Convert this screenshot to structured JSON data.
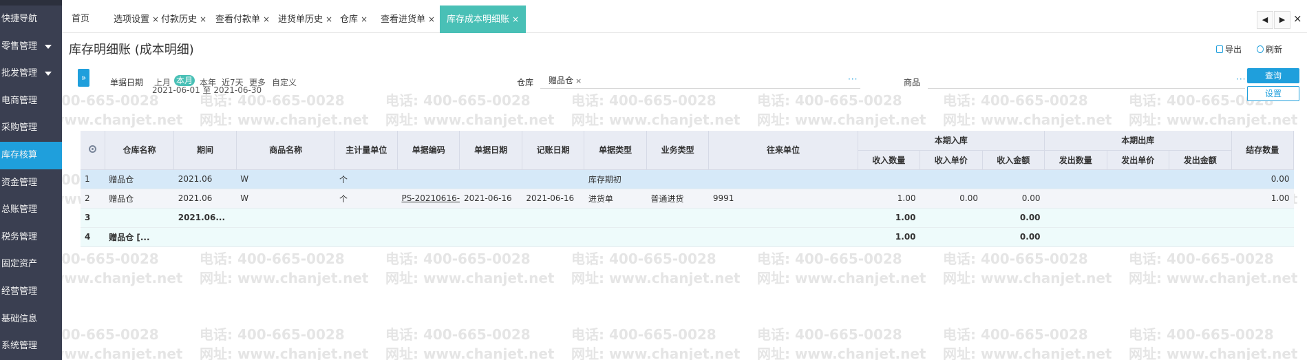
{
  "sidebar": {
    "items": [
      {
        "label": "快捷导航",
        "caret": false,
        "active": false
      },
      {
        "label": "零售管理",
        "caret": true,
        "active": false
      },
      {
        "label": "批发管理",
        "caret": true,
        "active": false
      },
      {
        "label": "电商管理",
        "caret": false,
        "active": false
      },
      {
        "label": "采购管理",
        "caret": false,
        "active": false
      },
      {
        "label": "库存核算",
        "caret": false,
        "active": true
      },
      {
        "label": "资金管理",
        "caret": false,
        "active": false
      },
      {
        "label": "总账管理",
        "caret": false,
        "active": false
      },
      {
        "label": "税务管理",
        "caret": false,
        "active": false
      },
      {
        "label": "固定资产",
        "caret": false,
        "active": false
      },
      {
        "label": "经营管理",
        "caret": false,
        "active": false
      },
      {
        "label": "基础信息",
        "caret": false,
        "active": false
      },
      {
        "label": "系统管理",
        "caret": false,
        "active": false
      }
    ]
  },
  "tabs": [
    {
      "label": "首页",
      "closable": false,
      "active": false
    },
    {
      "label": "选项设置",
      "closable": true,
      "active": false
    },
    {
      "label": "付款历史",
      "closable": true,
      "active": false
    },
    {
      "label": "查看付款单",
      "closable": true,
      "active": false
    },
    {
      "label": "进货单历史",
      "closable": true,
      "active": false
    },
    {
      "label": "仓库",
      "closable": true,
      "active": false
    },
    {
      "label": "查看进货单",
      "closable": true,
      "active": false
    },
    {
      "label": "库存成本明细账",
      "closable": true,
      "active": true
    }
  ],
  "tab_close_glyph": "×",
  "tab_nav": {
    "prev": "◀",
    "next": "▶",
    "close_all": "×"
  },
  "page": {
    "title": "库存明细账 (成本明细)",
    "export_label": "导出",
    "refresh_label": "刷新"
  },
  "filters": {
    "expand_glyph": "»",
    "date_label": "单据日期",
    "quick_options": [
      {
        "label": "上月",
        "active": false
      },
      {
        "label": "本月",
        "active": true
      },
      {
        "label": "本年",
        "active": false
      },
      {
        "label": "近7天",
        "active": false
      },
      {
        "label": "更多",
        "active": false
      },
      {
        "label": "自定义",
        "active": false
      }
    ],
    "date_range": "2021-06-01 至 2021-06-30",
    "warehouse_label": "仓库",
    "warehouse_chip": "赠品仓",
    "goods_label": "商品",
    "more_glyph": "···",
    "query_button": "查询",
    "settings_button": "设置"
  },
  "watermark": {
    "phone": "电话: 400-665-0028",
    "site": "网址: www.chanjet.net"
  },
  "table": {
    "headers": {
      "warehouse": "仓库名称",
      "period": "期间",
      "goods": "商品名称",
      "unit": "主计量单位",
      "doc_no": "单据编码",
      "doc_date": "单据日期",
      "post_date": "记账日期",
      "doc_type": "单据类型",
      "biz_type": "业务类型",
      "partner": "往来单位",
      "in_group": "本期入库",
      "out_group": "本期出库",
      "in_qty": "收入数量",
      "in_price": "收入单价",
      "in_amount": "收入金额",
      "out_qty": "发出数量",
      "out_price": "发出单价",
      "out_amount": "发出金额",
      "bal_qty": "结存数量"
    },
    "rows": [
      {
        "no": "1",
        "warehouse": "赠品仓",
        "period": "2021.06",
        "goods": "W",
        "unit": "个",
        "doc_no": "",
        "doc_date": "",
        "post_date": "",
        "doc_type": "库存期初",
        "biz_type": "",
        "partner": "",
        "in_qty": "",
        "in_price": "",
        "in_amount": "",
        "out_qty": "",
        "out_price": "",
        "out_amount": "",
        "bal_qty": "0.00"
      },
      {
        "no": "2",
        "warehouse": "赠品仓",
        "period": "2021.06",
        "goods": "W",
        "unit": "个",
        "doc_no": "PS-20210616-",
        "doc_date": "2021-06-16",
        "post_date": "2021-06-16",
        "doc_type": "进货单",
        "biz_type": "普通进货",
        "partner": "9991",
        "in_qty": "1.00",
        "in_price": "0.00",
        "in_amount": "0.00",
        "out_qty": "",
        "out_price": "",
        "out_amount": "",
        "bal_qty": "1.00"
      },
      {
        "no": "3",
        "warehouse": "",
        "period": "2021.06...",
        "goods": "",
        "unit": "",
        "doc_no": "",
        "doc_date": "",
        "post_date": "",
        "doc_type": "",
        "biz_type": "",
        "partner": "",
        "in_qty": "1.00",
        "in_price": "",
        "in_amount": "0.00",
        "out_qty": "",
        "out_price": "",
        "out_amount": "",
        "bal_qty": ""
      },
      {
        "no": "4",
        "warehouse": "赠品仓 [...",
        "period": "",
        "goods": "",
        "unit": "",
        "doc_no": "",
        "doc_date": "",
        "post_date": "",
        "doc_type": "",
        "biz_type": "",
        "partner": "",
        "in_qty": "1.00",
        "in_price": "",
        "in_amount": "0.00",
        "out_qty": "",
        "out_price": "",
        "out_amount": "",
        "bal_qty": ""
      }
    ]
  },
  "colors": {
    "sidebar_bg": "#3a3f51",
    "sidebar_active": "#1f9fdc",
    "tab_active": "#49c0b6",
    "accent": "#1f9fdc"
  }
}
